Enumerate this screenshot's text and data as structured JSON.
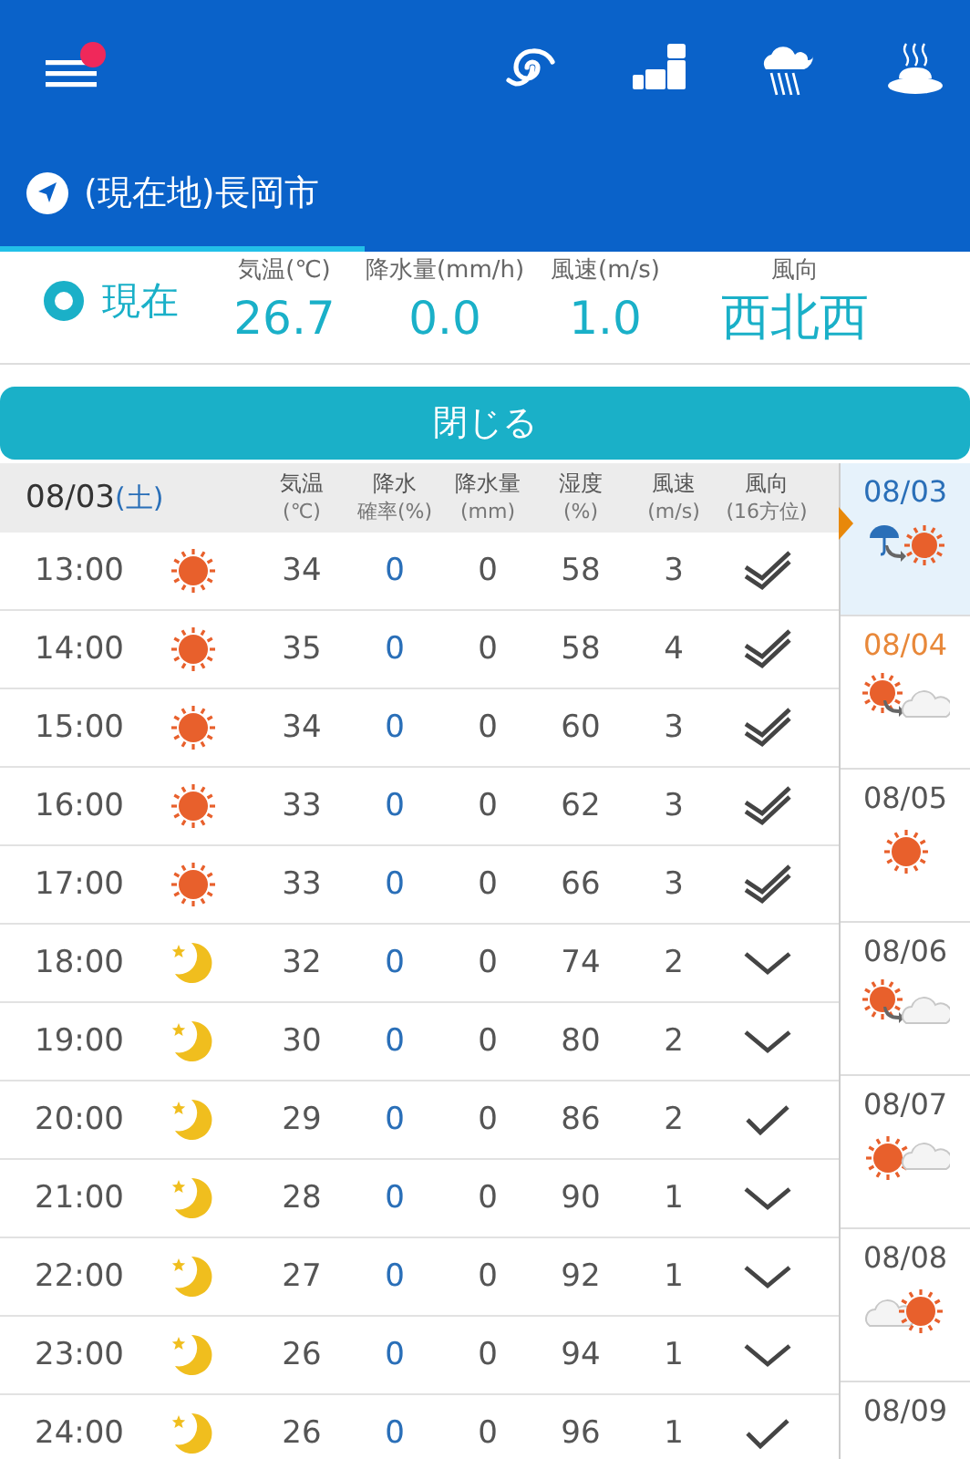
{
  "header": {
    "menu_badge": true,
    "location": "(現在地)長岡市"
  },
  "current": {
    "label": "現在",
    "columns": [
      {
        "label": "気温(℃)",
        "value": "26.7"
      },
      {
        "label": "降水量(mm/h)",
        "value": "0.0"
      },
      {
        "label": "風速(m/s)",
        "value": "1.0"
      },
      {
        "label": "風向",
        "value": "西北西"
      }
    ]
  },
  "close_button": "閉じる",
  "table": {
    "date": "08/03",
    "weekday": "(土)",
    "columns": [
      [
        "気温",
        "(℃)"
      ],
      [
        "降水",
        "確率(%)"
      ],
      [
        "降水量",
        "(mm)"
      ],
      [
        "湿度",
        "(%)"
      ],
      [
        "風速",
        "(m/s)"
      ],
      [
        "風向",
        "(16方位)"
      ]
    ],
    "rows": [
      {
        "time": "13:00",
        "weather": {
          "kind": "sun"
        },
        "temp": "34",
        "prob": "0",
        "amount": "0",
        "humidity": "58",
        "speed": "3",
        "wind": {
          "kind": "double"
        }
      },
      {
        "time": "14:00",
        "weather": {
          "kind": "sun"
        },
        "temp": "35",
        "prob": "0",
        "amount": "0",
        "humidity": "58",
        "speed": "4",
        "wind": {
          "kind": "double"
        }
      },
      {
        "time": "15:00",
        "weather": {
          "kind": "sun"
        },
        "temp": "34",
        "prob": "0",
        "amount": "0",
        "humidity": "60",
        "speed": "3",
        "wind": {
          "kind": "double"
        }
      },
      {
        "time": "16:00",
        "weather": {
          "kind": "sun"
        },
        "temp": "33",
        "prob": "0",
        "amount": "0",
        "humidity": "62",
        "speed": "3",
        "wind": {
          "kind": "double"
        }
      },
      {
        "time": "17:00",
        "weather": {
          "kind": "sun"
        },
        "temp": "33",
        "prob": "0",
        "amount": "0",
        "humidity": "66",
        "speed": "3",
        "wind": {
          "kind": "double"
        }
      },
      {
        "time": "18:00",
        "weather": {
          "kind": "moon"
        },
        "temp": "32",
        "prob": "0",
        "amount": "0",
        "humidity": "74",
        "speed": "2",
        "wind": {
          "kind": "down"
        }
      },
      {
        "time": "19:00",
        "weather": {
          "kind": "moon"
        },
        "temp": "30",
        "prob": "0",
        "amount": "0",
        "humidity": "80",
        "speed": "2",
        "wind": {
          "kind": "down"
        }
      },
      {
        "time": "20:00",
        "weather": {
          "kind": "moon"
        },
        "temp": "29",
        "prob": "0",
        "amount": "0",
        "humidity": "86",
        "speed": "2",
        "wind": {
          "kind": "check"
        }
      },
      {
        "time": "21:00",
        "weather": {
          "kind": "moon"
        },
        "temp": "28",
        "prob": "0",
        "amount": "0",
        "humidity": "90",
        "speed": "1",
        "wind": {
          "kind": "down"
        }
      },
      {
        "time": "22:00",
        "weather": {
          "kind": "moon"
        },
        "temp": "27",
        "prob": "0",
        "amount": "0",
        "humidity": "92",
        "speed": "1",
        "wind": {
          "kind": "down"
        }
      },
      {
        "time": "23:00",
        "weather": {
          "kind": "moon"
        },
        "temp": "26",
        "prob": "0",
        "amount": "0",
        "humidity": "94",
        "speed": "1",
        "wind": {
          "kind": "down"
        }
      },
      {
        "time": "24:00",
        "weather": {
          "kind": "moon"
        },
        "temp": "26",
        "prob": "0",
        "amount": "0",
        "humidity": "96",
        "speed": "1",
        "wind": {
          "kind": "check"
        }
      }
    ]
  },
  "days": [
    {
      "date": "08/03",
      "selected": true,
      "color": "#2a6fb8",
      "kind": "rain_to_sun"
    },
    {
      "date": "08/04",
      "selected": false,
      "color": "#e8883a",
      "kind": "sun_to_cloud"
    },
    {
      "date": "08/05",
      "selected": false,
      "color": "#555555",
      "kind": "sun"
    },
    {
      "date": "08/06",
      "selected": false,
      "color": "#555555",
      "kind": "sun_to_cloud"
    },
    {
      "date": "08/07",
      "selected": false,
      "color": "#555555",
      "kind": "sun_cloud"
    },
    {
      "date": "08/08",
      "selected": false,
      "color": "#555555",
      "kind": "cloud_sun"
    },
    {
      "date": "08/09",
      "selected": false,
      "color": "#555555"
    }
  ]
}
